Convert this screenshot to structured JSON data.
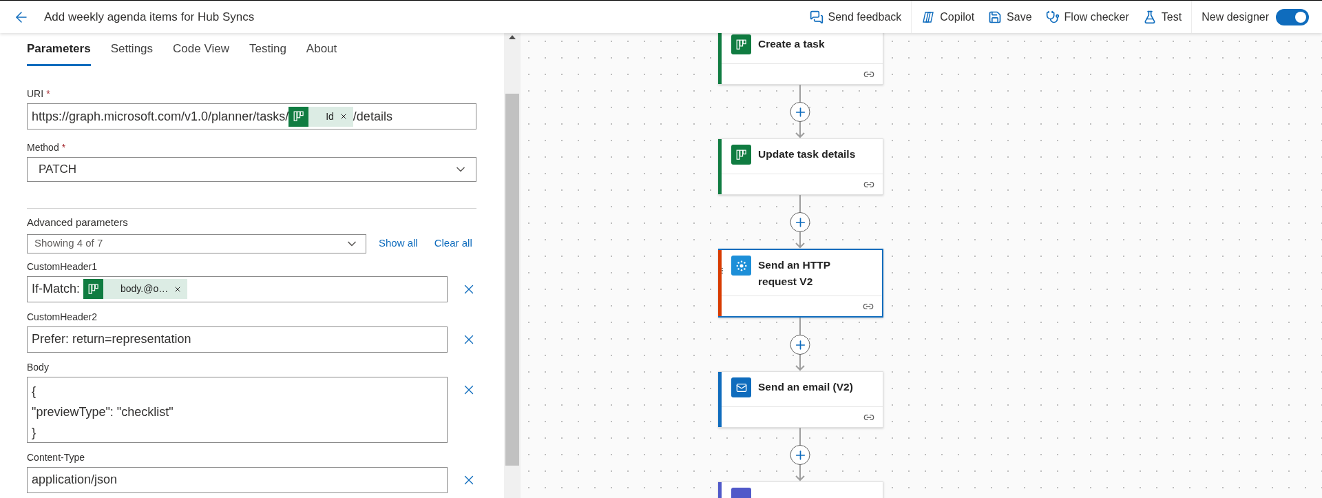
{
  "header": {
    "title": "Add weekly agenda items for Hub Syncs",
    "action_groups": [
      [
        {
          "kind": "feedback",
          "label": "Send feedback"
        }
      ],
      [
        {
          "kind": "copilot",
          "label": "Copilot"
        },
        {
          "kind": "save",
          "label": "Save"
        },
        {
          "kind": "checker",
          "label": "Flow checker"
        },
        {
          "kind": "test",
          "label": "Test"
        }
      ]
    ],
    "toggle": {
      "label": "New designer",
      "on": true
    }
  },
  "panel": {
    "tabs": [
      {
        "label": "Parameters",
        "selected": true
      },
      {
        "label": "Settings",
        "selected": false
      },
      {
        "label": "Code View",
        "selected": false
      },
      {
        "label": "Testing",
        "selected": false
      },
      {
        "label": "About",
        "selected": false
      }
    ],
    "fields": [
      {
        "kind": "token",
        "label": "URI",
        "required_mark": "*",
        "parts": [
          {
            "kind": "text",
            "text": "https://graph.microsoft.com/v1.0/planner/tasks/"
          },
          {
            "kind": "token",
            "text": "Id"
          },
          {
            "kind": "text",
            "text": "/details"
          }
        ]
      },
      {
        "kind": "select",
        "label": "Method",
        "required_mark": "*",
        "value": "PATCH"
      }
    ],
    "advanced": {
      "label": "Advanced parameters",
      "value": "Showing 4 of 7",
      "links": [
        "Show all",
        "Clear all"
      ],
      "fields": [
        {
          "kind": "token",
          "label": "CustomHeader1",
          "parts": [
            {
              "kind": "text",
              "text": "If-Match: "
            },
            {
              "kind": "token",
              "text": "body.@o…"
            }
          ]
        },
        {
          "kind": "text",
          "label": "CustomHeader2",
          "value": "Prefer: return=representation"
        },
        {
          "kind": "multiline",
          "label": "Body",
          "lines": [
            "{",
            "\"previewType\": \"checklist\"",
            "}"
          ]
        },
        {
          "kind": "text",
          "label": "Content-Type",
          "value": "application/json"
        }
      ]
    }
  },
  "canvas": {
    "nodes": [
      {
        "kind": "planner",
        "title": "Create a task",
        "color": "#107c41",
        "selected": false
      },
      {
        "kind": "planner",
        "title": "Update task details",
        "color": "#107c41",
        "selected": false
      },
      {
        "kind": "http",
        "title": "Send an HTTP request V2",
        "color": "#d83b01",
        "selected": true
      },
      {
        "kind": "outlook",
        "title": "Send an email (V2)",
        "color": "#0f6cbd",
        "selected": false
      },
      {
        "kind": "teams",
        "color": "#5059c9",
        "selected": false
      }
    ]
  }
}
